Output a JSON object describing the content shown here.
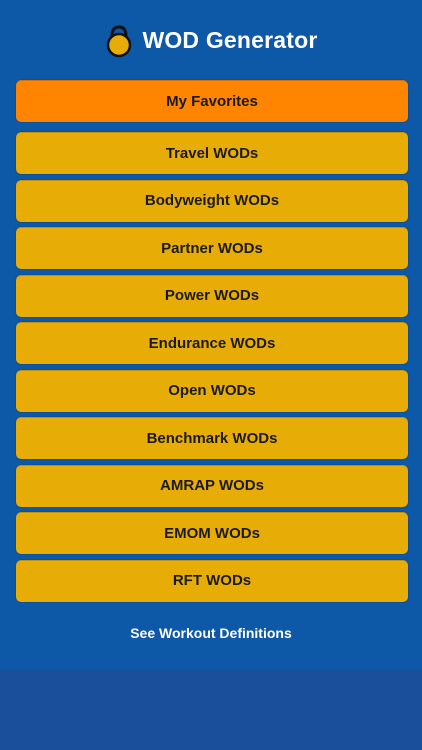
{
  "header": {
    "title": "WOD Generator",
    "icon": "kettlebell-icon"
  },
  "colors": {
    "background": "#1a4f9c",
    "panel": "#0e58a8",
    "favorites_button": "#ff8400",
    "menu_button": "#e7ad06",
    "button_text": "#1a1a1a",
    "title_text": "#ffffff"
  },
  "menu": {
    "favorites_label": "My Favorites",
    "items": [
      {
        "label": "Travel WODs"
      },
      {
        "label": "Bodyweight WODs"
      },
      {
        "label": "Partner WODs"
      },
      {
        "label": "Power WODs"
      },
      {
        "label": "Endurance WODs"
      },
      {
        "label": "Open WODs"
      },
      {
        "label": "Benchmark WODs"
      },
      {
        "label": "AMRAP WODs"
      },
      {
        "label": "EMOM WODs"
      },
      {
        "label": "RFT WODs"
      }
    ]
  },
  "footer": {
    "definitions_link": "See Workout Definitions"
  }
}
